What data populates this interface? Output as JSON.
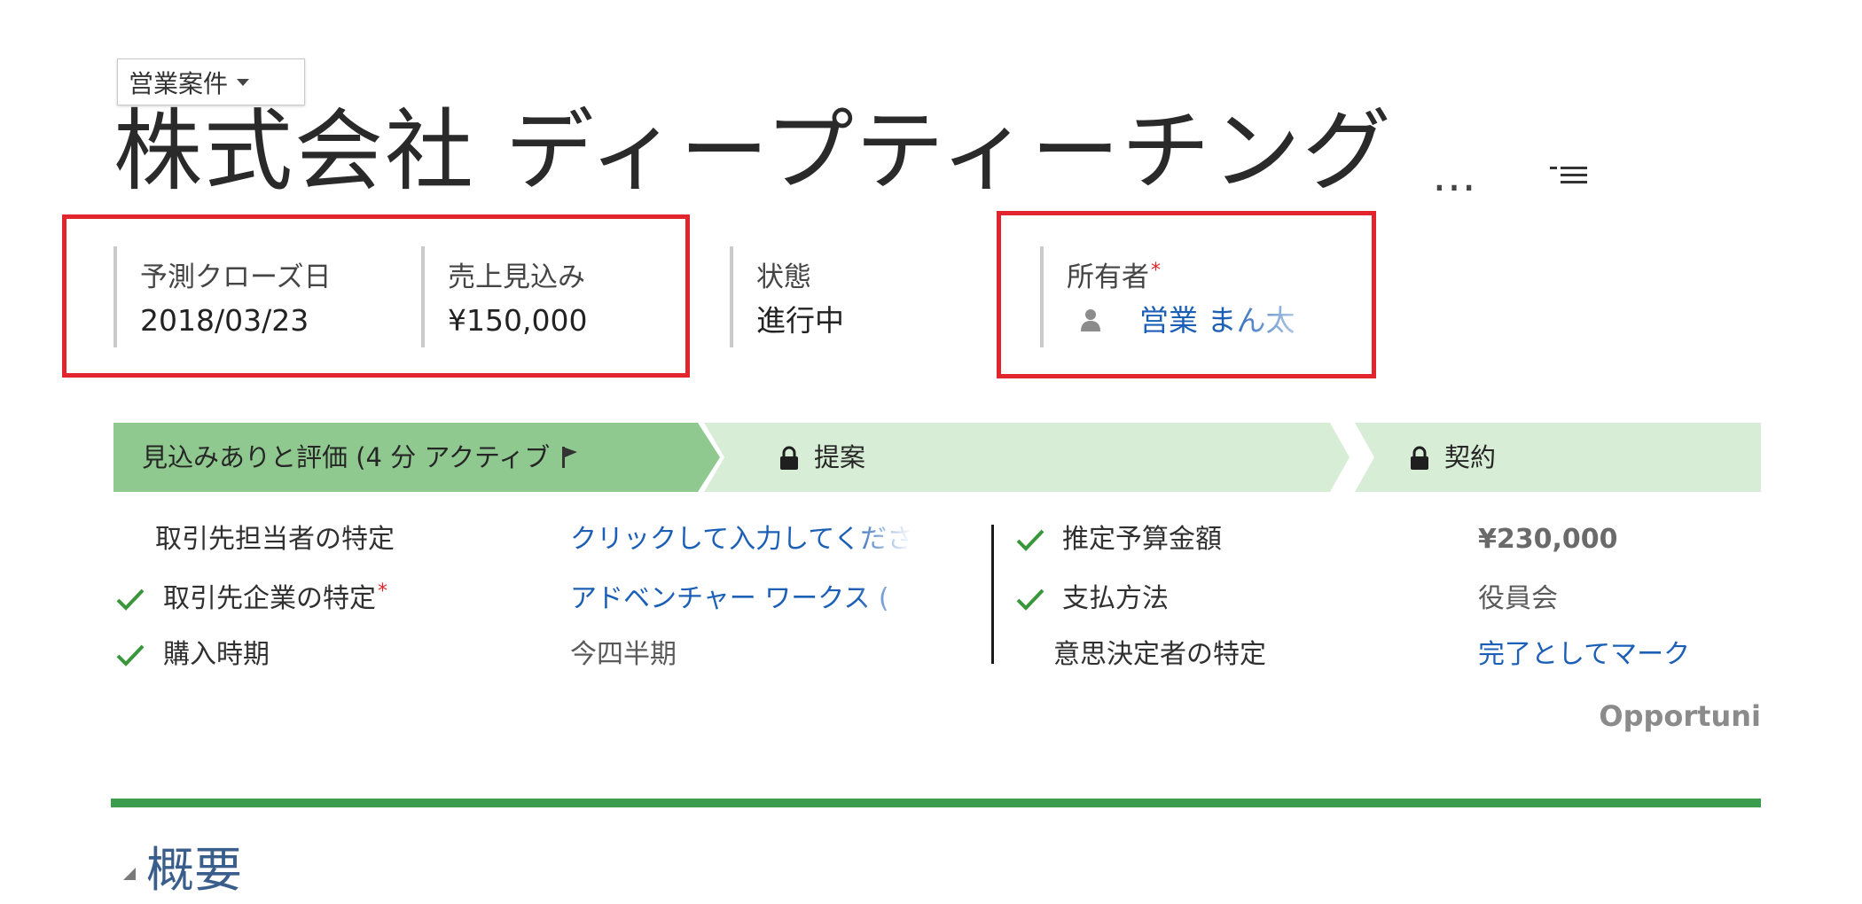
{
  "record": {
    "entity_selector": {
      "label": "営業案件",
      "icon": "caret-down-icon"
    },
    "title": "株式会社 ディープティーチング",
    "more_label": "…",
    "menu_icon": "list-menu-icon"
  },
  "header_fields": [
    {
      "label": "予測クローズ日",
      "value": "2018/03/23"
    },
    {
      "label": "売上見込み",
      "value": "¥150,000"
    },
    {
      "label": "状態",
      "value": "進行中"
    },
    {
      "label": "所有者",
      "required": "*",
      "value": "営業 まん太",
      "icon": "user-icon"
    }
  ],
  "process": {
    "name": "Opportuni",
    "stages": [
      {
        "label": "見込みありと評価 (4 分 アクティブ",
        "active": true,
        "icon": "flag-icon"
      },
      {
        "label": "提案",
        "active": false,
        "icon": "lock-icon"
      },
      {
        "label": "契約",
        "active": false,
        "icon": "lock-icon"
      }
    ],
    "steps": {
      "left": [
        {
          "checked": false,
          "label": "取引先担当者の特定",
          "value": "クリックして入力してくださ"
        },
        {
          "checked": true,
          "label": "取引先企業の特定",
          "required": "*",
          "value": "アドベンチャー ワークス ("
        },
        {
          "checked": true,
          "label": "購入時期",
          "value": "今四半期"
        }
      ],
      "right": [
        {
          "checked": true,
          "label": "推定予算金額",
          "value": "¥230,000"
        },
        {
          "checked": true,
          "label": "支払方法",
          "value": "役員会"
        },
        {
          "checked": false,
          "label": "意思決定者の特定",
          "value": "完了としてマーク"
        }
      ]
    }
  },
  "sections": [
    {
      "title": "概要",
      "icon": "expand-triangle-icon"
    }
  ],
  "colors": {
    "highlight": "#e2252d",
    "active_stage": "#8fc98f",
    "inactive_stage": "#d8edd6",
    "link": "#1c5fb6",
    "rule": "#3c9c4e",
    "check": "#3a963b",
    "required": "#e2252d"
  }
}
